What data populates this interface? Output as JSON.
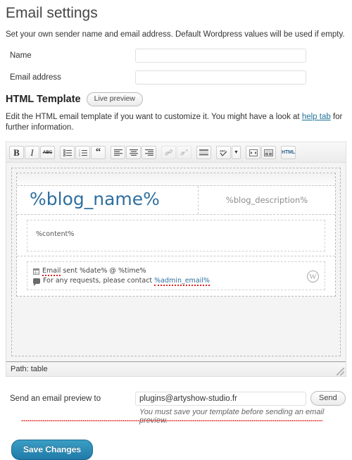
{
  "page": {
    "title": "Email settings",
    "description": "Set your own sender name and email address. Default Wordpress values will be used if empty."
  },
  "sender_form": {
    "name_label": "Name",
    "name_value": "",
    "email_label": "Email address",
    "email_value": ""
  },
  "template_section": {
    "title": "HTML Template",
    "live_preview_label": "Live preview",
    "description_before": "Edit the HTML email template if you want to customize it. You might have a look at ",
    "help_link_label": "help tab",
    "description_after": " for further information."
  },
  "toolbar": {
    "buttons": [
      {
        "name": "bold",
        "glyph": "B",
        "style": "b",
        "disabled": false
      },
      {
        "name": "italic",
        "glyph": "I",
        "style": "i",
        "disabled": false
      },
      {
        "name": "strikethrough",
        "glyph": "ABC",
        "style": "mini-strike",
        "disabled": false
      },
      {
        "name": "unordered-list",
        "glyph": "list-bullet",
        "style": "icon",
        "disabled": false
      },
      {
        "name": "ordered-list",
        "glyph": "list-number",
        "style": "icon",
        "disabled": false
      },
      {
        "name": "blockquote",
        "glyph": "“",
        "style": "quote",
        "disabled": false
      },
      {
        "name": "align-left",
        "glyph": "align-left",
        "style": "icon",
        "disabled": false
      },
      {
        "name": "align-center",
        "glyph": "align-center",
        "style": "icon",
        "disabled": false
      },
      {
        "name": "align-right",
        "glyph": "align-right",
        "style": "icon",
        "disabled": false
      },
      {
        "name": "insert-link",
        "glyph": "link",
        "style": "icon",
        "disabled": true
      },
      {
        "name": "unlink",
        "glyph": "unlink",
        "style": "icon",
        "disabled": true
      },
      {
        "name": "insert-more-tag",
        "glyph": "more",
        "style": "icon",
        "disabled": false
      },
      {
        "name": "spellcheck",
        "glyph": "ABC-check",
        "style": "icon",
        "disabled": false
      },
      {
        "name": "spellcheck-dropdown",
        "glyph": "▾",
        "style": "arrow",
        "disabled": false
      },
      {
        "name": "fullscreen",
        "glyph": "fullscreen",
        "style": "icon",
        "disabled": false
      },
      {
        "name": "kitchen-sink",
        "glyph": "kitchen-sink",
        "style": "icon",
        "disabled": false
      },
      {
        "name": "html-mode",
        "glyph": "HTML",
        "style": "html",
        "disabled": false
      }
    ]
  },
  "email_template": {
    "blog_name": "%blog_name%",
    "blog_description": "%blog_description%",
    "content": "%content%",
    "footer_date_line_prefix": "Email",
    "footer_date_line_rest": " sent %date% @ %time%",
    "footer_contact_prefix": "For any requests, please contact ",
    "footer_contact_link": "%admin_email%",
    "wp_logo_glyph": "W"
  },
  "statusbar": {
    "path_text": "Path: table"
  },
  "preview": {
    "label": "Send an email preview to",
    "email_value": "plugins@artyshow-studio.fr",
    "send_button": "Send",
    "note": "You must save your template before sending an email preview."
  },
  "actions": {
    "save_label": "Save Changes"
  },
  "colors": {
    "link": "#21759b",
    "blog_name": "#2f6f9f",
    "save_button": "#207aa8",
    "spellcheck_red": "#e02020"
  }
}
